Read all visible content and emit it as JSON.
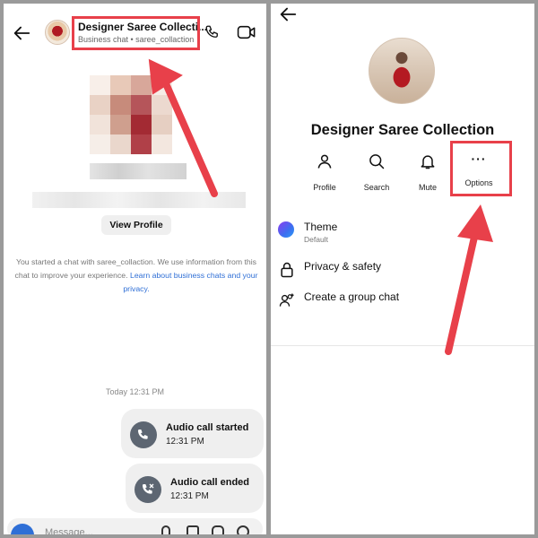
{
  "left": {
    "header": {
      "title": "Designer Saree Collecti...",
      "subtitle": "Business chat • saree_collaction"
    },
    "view_profile_label": "View Profile",
    "intro": {
      "text": "You started a chat with saree_collaction. We use information from this chat to improve your experience.",
      "link": "Learn about business chats and your privacy."
    },
    "timestamp": "Today 12:31 PM",
    "calls": [
      {
        "title": "Audio call started",
        "time": "12:31 PM"
      },
      {
        "title": "Audio call ended",
        "time": "12:31 PM"
      }
    ],
    "composer_placeholder": "Message..."
  },
  "right": {
    "profile_name": "Designer Saree Collection",
    "actions": [
      {
        "label": "Profile",
        "icon": "person-icon"
      },
      {
        "label": "Search",
        "icon": "search-icon"
      },
      {
        "label": "Mute",
        "icon": "bell-icon"
      },
      {
        "label": "Options",
        "icon": "more-icon"
      }
    ],
    "menu": [
      {
        "label": "Theme",
        "sub": "Default",
        "icon": "theme-icon"
      },
      {
        "label": "Privacy & safety",
        "icon": "lock-icon"
      },
      {
        "label": "Create a group chat",
        "icon": "group-add-icon"
      }
    ]
  },
  "colors": {
    "highlight": "#e8404a",
    "link": "#2f6fd6",
    "bubble": "#efefef"
  }
}
